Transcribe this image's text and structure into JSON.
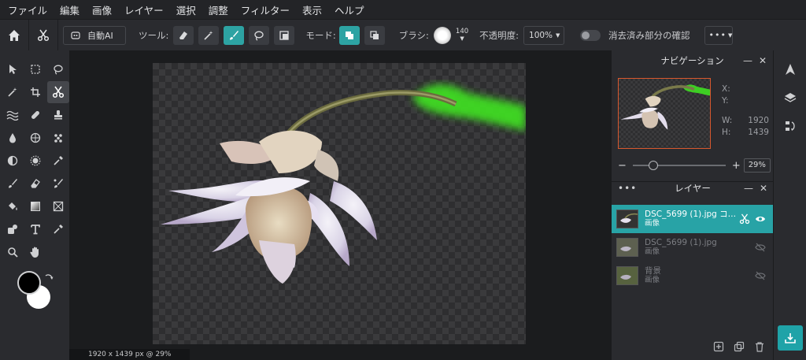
{
  "menu": [
    "ファイル",
    "編集",
    "画像",
    "レイヤー",
    "選択",
    "調整",
    "フィルター",
    "表示",
    "ヘルプ"
  ],
  "toolbar": {
    "auto_ai": "自動AI",
    "tool_label": "ツール:",
    "mode_label": "モード:",
    "brush_label": "ブラシ:",
    "brush_size": "140",
    "opacity_label": "不透明度:",
    "opacity_value": "100%",
    "confirm_label": "消去済み部分の確認"
  },
  "status": "1920 x 1439 px @ 29%",
  "navigator": {
    "title": "ナビゲーション",
    "x_label": "X:",
    "y_label": "Y:",
    "w_label": "W:",
    "w_value": "1920",
    "h_label": "H:",
    "h_value": "1439",
    "zoom_value": "29%"
  },
  "layers_panel": {
    "title": "レイヤー",
    "items": [
      {
        "name": "DSC_5699 (1).jpg コ…",
        "type": "画像"
      },
      {
        "name": "DSC_5699 (1).jpg",
        "type": "画像"
      },
      {
        "name": "背景",
        "type": "画像"
      }
    ]
  },
  "colors": {
    "accent": "#28a3a6",
    "nav_border": "#d8582e",
    "foreground": "#000000",
    "background": "#ffffff"
  }
}
